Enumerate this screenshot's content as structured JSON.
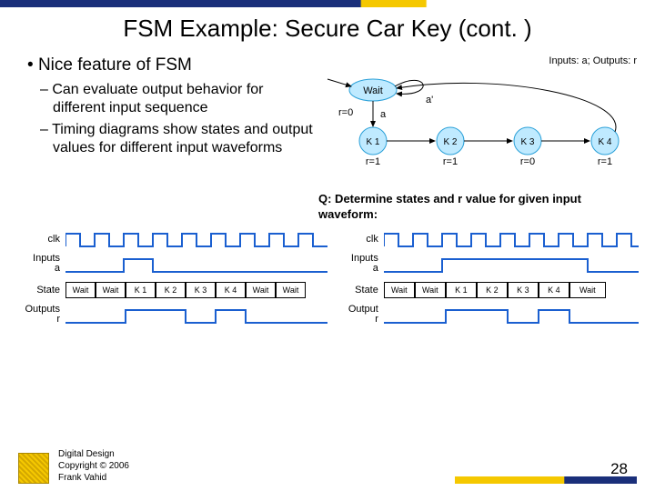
{
  "title": "FSM Example: Secure Car Key (cont. )",
  "bullets": {
    "main": "Nice feature of FSM",
    "sub1": "Can evaluate output behavior for different input sequence",
    "sub2": "Timing diagrams show states and output values for different input waveforms"
  },
  "io_text": "Inputs: a; Outputs: r",
  "fsm": {
    "wait": "Wait",
    "r0": "r=0",
    "a": "a",
    "ap": "a'",
    "k1": "K 1",
    "k2": "K 2",
    "k3": "K 3",
    "k4": "K 4",
    "o1": "r=1",
    "o2": "r=1",
    "o3": "r=0",
    "o4": "r=1"
  },
  "question": "Q: Determine states and r value for given input waveform:",
  "timing_labels": {
    "clk": "clk",
    "inputs_a_l": "Inputs",
    "a": "a",
    "state": "State",
    "outputs_l": "Outputs",
    "output_r": "Output",
    "r": "r"
  },
  "states_left": [
    "Wait",
    "Wait",
    "K 1",
    "K 2",
    "K 3",
    "K 4",
    "Wait",
    "Wait"
  ],
  "states_right": [
    "Wait",
    "Wait",
    "K 1",
    "K 2",
    "K 3",
    "K 4",
    "Wait"
  ],
  "footer": {
    "l1": "Digital Design",
    "l2": "Copyright © 2006",
    "l3": "Frank Vahid"
  },
  "page": "28",
  "chart_data": {
    "type": "table",
    "description": "FSM state diagram and two timing diagrams",
    "fsm_states": [
      {
        "name": "Wait",
        "output": "r=0",
        "transitions": [
          {
            "cond": "a'",
            "to": "Wait"
          },
          {
            "cond": "a",
            "to": "K1"
          }
        ]
      },
      {
        "name": "K1",
        "output": "r=1",
        "transitions": [
          {
            "cond": "",
            "to": "K2"
          }
        ]
      },
      {
        "name": "K2",
        "output": "r=1",
        "transitions": [
          {
            "cond": "",
            "to": "K3"
          }
        ]
      },
      {
        "name": "K3",
        "output": "r=0",
        "transitions": [
          {
            "cond": "",
            "to": "K4"
          }
        ]
      },
      {
        "name": "K4",
        "output": "r=1",
        "transitions": [
          {
            "cond": "",
            "to": "Wait"
          }
        ]
      }
    ],
    "timing_left": {
      "clk_periods": 9,
      "a": [
        0,
        0,
        1,
        0,
        0,
        0,
        0,
        0,
        0
      ],
      "state": [
        "Wait",
        "Wait",
        "K1",
        "K2",
        "K3",
        "K4",
        "Wait",
        "Wait"
      ],
      "r": [
        0,
        0,
        1,
        1,
        0,
        1,
        0,
        0,
        0
      ]
    },
    "timing_right": {
      "clk_periods": 9,
      "a": [
        0,
        0,
        1,
        1,
        1,
        1,
        1,
        0,
        0
      ],
      "state": [
        "Wait",
        "Wait",
        "K1",
        "K2",
        "K3",
        "K4",
        "Wait"
      ],
      "r": [
        0,
        0,
        1,
        1,
        0,
        1,
        0,
        0,
        0
      ]
    }
  }
}
